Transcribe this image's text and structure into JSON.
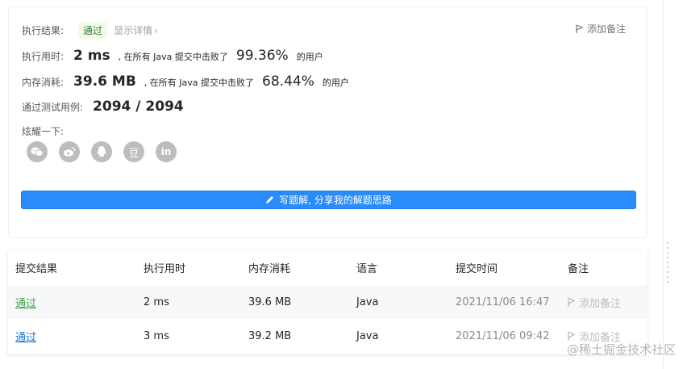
{
  "result": {
    "label": "执行结果:",
    "status": "通过",
    "detail_link": "显示详情",
    "add_note": "添加备注"
  },
  "runtime": {
    "label": "执行用时:",
    "value": "2 ms",
    "mid_text": ", 在所有 Java 提交中击败了",
    "percent": "99.36%",
    "suffix": "的用户"
  },
  "memory": {
    "label": "内存消耗:",
    "value": "39.6 MB",
    "mid_text": ", 在所有 Java 提交中击败了",
    "percent": "68.44%",
    "suffix": "的用户"
  },
  "tests": {
    "label": "通过测试用例:",
    "value": "2094 / 2094"
  },
  "share": {
    "label": "炫耀一下:",
    "icons": [
      "wechat-icon",
      "weibo-icon",
      "qq-icon",
      "douban-icon",
      "linkedin-icon"
    ]
  },
  "write_button": "写题解, 分享我的解题思路",
  "table": {
    "headers": [
      "提交结果",
      "执行用时",
      "内存消耗",
      "语言",
      "提交时间",
      "备注"
    ],
    "rows": [
      {
        "status": "通过",
        "runtime": "2 ms",
        "memory": "39.6 MB",
        "language": "Java",
        "time": "2021/11/06 16:47",
        "note": "添加备注"
      },
      {
        "status": "通过",
        "runtime": "3 ms",
        "memory": "39.2 MB",
        "language": "Java",
        "time": "2021/11/06 09:42",
        "note": "添加备注"
      }
    ]
  },
  "watermark": "@稀土掘金技术社区",
  "colors": {
    "accent": "#2a8cfa",
    "success": "#43a047",
    "link": "#1976d2"
  }
}
